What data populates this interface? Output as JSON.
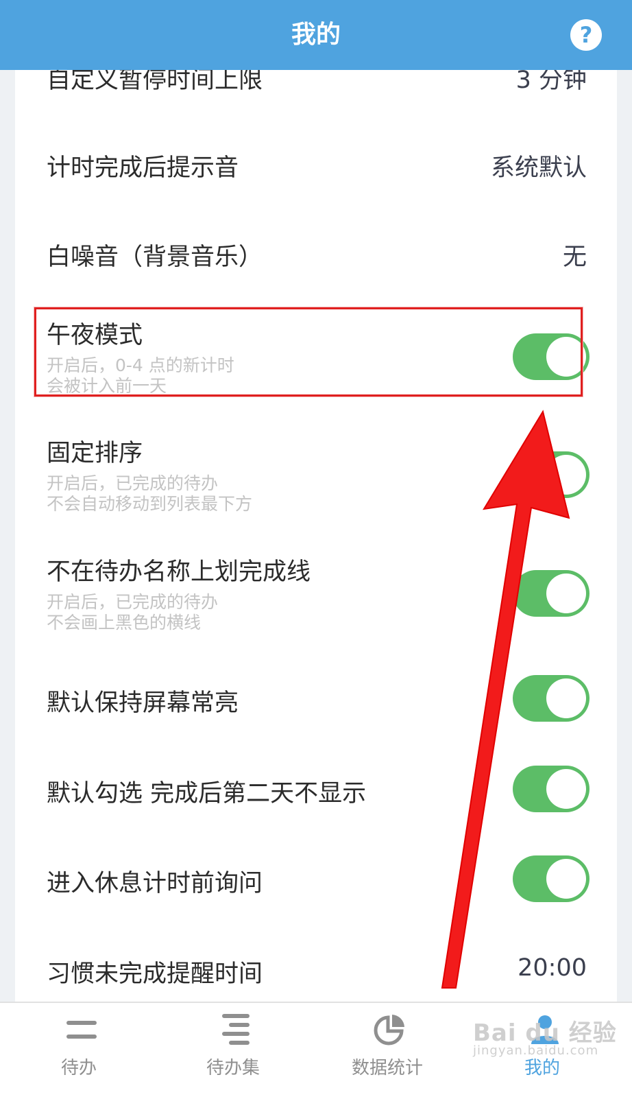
{
  "header": {
    "title": "我的",
    "help_label": "?"
  },
  "settings": [
    {
      "label": "自定义暂停时间上限",
      "value": "3 分钟"
    },
    {
      "label": "计时完成后提示音",
      "value": "系统默认"
    },
    {
      "label": "白噪音（背景音乐）",
      "value": "无"
    },
    {
      "label": "午夜模式",
      "desc1": "开启后，0-4 点的新计时",
      "desc2": "会被计入前一天",
      "toggle": true
    },
    {
      "label": "固定排序",
      "desc1": "开启后，已完成的待办",
      "desc2": "不会自动移动到列表最下方",
      "toggle": true
    },
    {
      "label": "不在待办名称上划完成线",
      "desc1": "开启后，已完成的待办",
      "desc2": "不会画上黑色的横线",
      "toggle": true
    },
    {
      "label": "默认保持屏幕常亮",
      "toggle": true
    },
    {
      "label": "默认勾选 完成后第二天不显示",
      "toggle": true
    },
    {
      "label": "进入休息计时前询问",
      "toggle": true
    },
    {
      "label": "习惯未完成提醒时间",
      "value": "20:00"
    }
  ],
  "nav": [
    {
      "label": "待办",
      "icon": "todo-icon"
    },
    {
      "label": "待办集",
      "icon": "todo-set-icon"
    },
    {
      "label": "数据统计",
      "icon": "pie-chart-icon"
    },
    {
      "label": "我的",
      "icon": "profile-icon",
      "active": true
    }
  ],
  "colors": {
    "header": "#4fa3df",
    "toggle_on": "#5cbd67",
    "highlight": "#e02020",
    "arrow": "#f21b1b"
  },
  "watermark": {
    "brand": "Bai du 经验",
    "url": "jingyan.baidu.com"
  }
}
